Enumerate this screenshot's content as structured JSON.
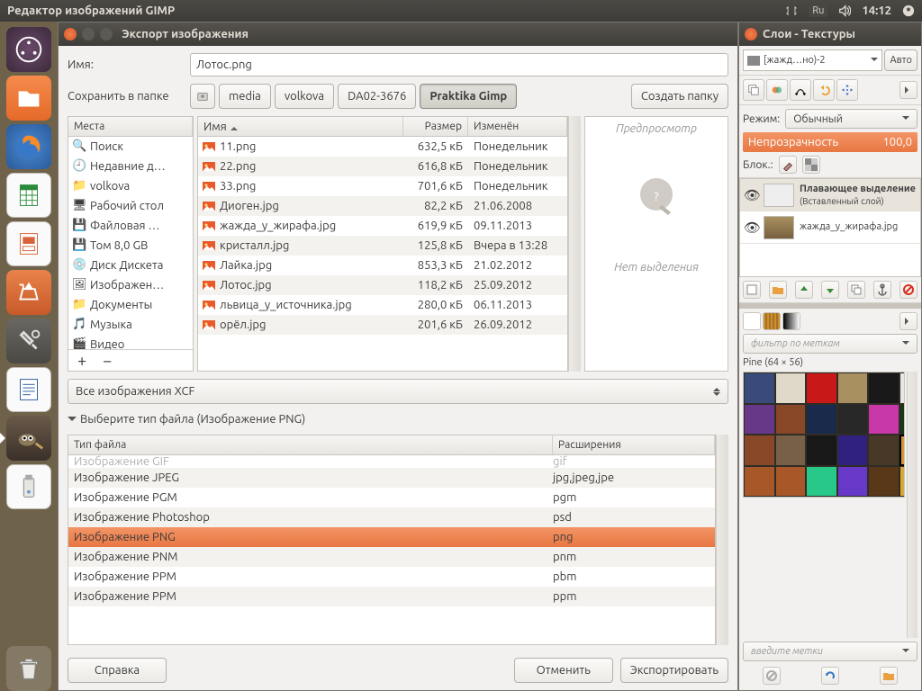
{
  "topbar": {
    "title": "Редактор изображений GIMP",
    "lang": "Ru",
    "time": "14:12"
  },
  "launcher": {
    "items": [
      "dash",
      "files",
      "firefox",
      "calc",
      "impress",
      "software",
      "settings",
      "writer",
      "gimp",
      "usb"
    ]
  },
  "dialog": {
    "title": "Экспорт изображения",
    "name_label": "Имя:",
    "name_value": "Лотос.png",
    "save_in_label": "Сохранить в папке",
    "path": [
      "media",
      "volkova",
      "DA02-3676",
      "Praktika Gimp"
    ],
    "create_folder": "Создать папку",
    "places_header": "Места",
    "places": [
      "Поиск",
      "Недавние д…",
      "volkova",
      "Рабочий стол",
      "Файловая …",
      "Том 8,0 GB",
      "Диск Дискета",
      "Изображен…",
      "Документы",
      "Музыка",
      "Видео"
    ],
    "files_headers": {
      "name": "Имя",
      "size": "Размер",
      "mod": "Изменён"
    },
    "files": [
      {
        "n": "11.png",
        "s": "632,5 кБ",
        "m": "Понедельник",
        "t": "img"
      },
      {
        "n": "22.png",
        "s": "616,8 кБ",
        "m": "Понедельник",
        "t": "img"
      },
      {
        "n": "33.png",
        "s": "701,6 кБ",
        "m": "Понедельник",
        "t": "img"
      },
      {
        "n": "Диоген.jpg",
        "s": "82,2 кБ",
        "m": "21.06.2008",
        "t": "img"
      },
      {
        "n": "жажда_у_жирафа.jpg",
        "s": "619,9 кБ",
        "m": "09.11.2013",
        "t": "img"
      },
      {
        "n": "кристалл.jpg",
        "s": "125,8 кБ",
        "m": "Вчера в 13:28",
        "t": "img"
      },
      {
        "n": "Лайка.jpg",
        "s": "853,3 кБ",
        "m": "21.02.2012",
        "t": "img"
      },
      {
        "n": "Лотос.jpg",
        "s": "118,2 кБ",
        "m": "25.09.2012",
        "t": "img"
      },
      {
        "n": "львица_у_источника.jpg",
        "s": "280,0 кБ",
        "m": "06.11.2013",
        "t": "img"
      },
      {
        "n": "орёл.jpg",
        "s": "201,6 кБ",
        "m": "26.09.2012",
        "t": "img"
      }
    ],
    "preview_title": "Предпросмотр",
    "preview_empty": "Нет выделения",
    "filter": "Все изображения XCF",
    "disclosure": "Выберите тип файла (Изображение PNG)",
    "type_headers": {
      "type": "Тип файла",
      "ext": "Расширения"
    },
    "types": [
      {
        "t": "Изображение GIF",
        "e": "gif"
      },
      {
        "t": "Изображение JPEG",
        "e": "jpg,jpeg,jpe"
      },
      {
        "t": "Изображение PGM",
        "e": "pgm"
      },
      {
        "t": "Изображение Photoshop",
        "e": "psd"
      },
      {
        "t": "Изображение PNG",
        "e": "png"
      },
      {
        "t": "Изображение PNM",
        "e": "pnm"
      },
      {
        "t": "Изображение PPM",
        "e": "pbm"
      },
      {
        "t": "Изображение PPM",
        "e": "ppm"
      }
    ],
    "selected_type": 4,
    "buttons": {
      "help": "Справка",
      "cancel": "Отменить",
      "export": "Экспортировать"
    }
  },
  "layers": {
    "title": "Слои - Текстуры",
    "image_sel": "[жажд…но)-2",
    "auto": "Авто",
    "mode_label": "Режим:",
    "mode_value": "Обычный",
    "opacity_label": "Непрозрачность",
    "opacity_value": "100,0",
    "lock_label": "Блок.:",
    "layers_list": [
      {
        "name": "Плавающее выделение",
        "sub": "(Вставленный слой)"
      },
      {
        "name": "жажда_у_жирафа.jpg",
        "sub": ""
      }
    ],
    "texture_filter_ph": "фильтр по меткам",
    "texture_info": "Pine (64 × 56)",
    "texture_tag_ph": "введите метки"
  }
}
